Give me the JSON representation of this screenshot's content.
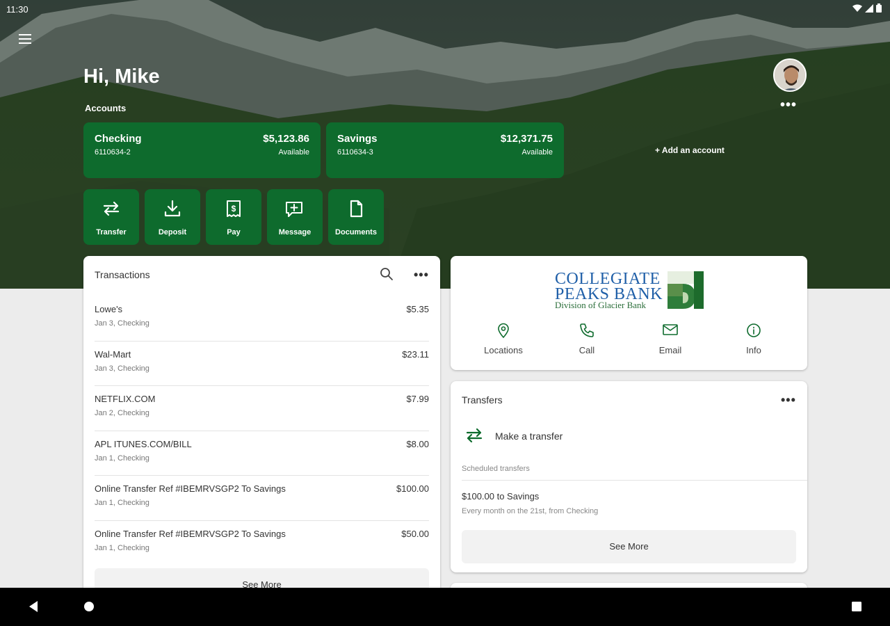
{
  "status_bar": {
    "time": "11:30"
  },
  "header": {
    "greeting": "Hi, Mike",
    "accounts_label": "Accounts",
    "add_account": "+ Add an account"
  },
  "accounts": [
    {
      "name": "Checking",
      "number": "6110634-2",
      "balance": "$5,123.86",
      "status": "Available"
    },
    {
      "name": "Savings",
      "number": "6110634-3",
      "balance": "$12,371.75",
      "status": "Available"
    }
  ],
  "actions": [
    {
      "label": "Transfer",
      "icon": "transfer-icon"
    },
    {
      "label": "Deposit",
      "icon": "deposit-icon"
    },
    {
      "label": "Pay",
      "icon": "pay-icon"
    },
    {
      "label": "Message",
      "icon": "message-icon"
    },
    {
      "label": "Documents",
      "icon": "document-icon"
    }
  ],
  "transactions": {
    "title": "Transactions",
    "items": [
      {
        "name": "Lowe's",
        "detail": "Jan 3, Checking",
        "amount": "$5.35"
      },
      {
        "name": "Wal-Mart",
        "detail": "Jan 3, Checking",
        "amount": "$23.11"
      },
      {
        "name": "NETFLIX.COM",
        "detail": "Jan 2, Checking",
        "amount": "$7.99"
      },
      {
        "name": "APL ITUNES.COM/BILL",
        "detail": "Jan 1, Checking",
        "amount": "$8.00"
      },
      {
        "name": "Online Transfer Ref #IBEMRVSGP2 To Savings",
        "detail": "Jan 1, Checking",
        "amount": "$100.00"
      },
      {
        "name": "Online Transfer Ref #IBEMRVSGP2 To Savings",
        "detail": "Jan 1, Checking",
        "amount": "$50.00"
      }
    ],
    "see_more": "See More"
  },
  "bank": {
    "logo_line1": "COLLEGIATE",
    "logo_line2": "PEAKS BANK",
    "logo_line3": "Division of Glacier Bank",
    "contacts": [
      {
        "label": "Locations",
        "icon": "location-pin-icon"
      },
      {
        "label": "Call",
        "icon": "phone-icon"
      },
      {
        "label": "Email",
        "icon": "email-icon"
      },
      {
        "label": "Info",
        "icon": "info-icon"
      }
    ]
  },
  "transfers": {
    "title": "Transfers",
    "make_transfer": "Make a transfer",
    "scheduled_label": "Scheduled transfers",
    "scheduled_title": "$100.00 to Savings",
    "scheduled_sub": "Every month on the 21st, from Checking",
    "see_more": "See More"
  },
  "colors": {
    "brand_green": "#0e6b2d",
    "logo_blue": "#1f5fa8"
  }
}
